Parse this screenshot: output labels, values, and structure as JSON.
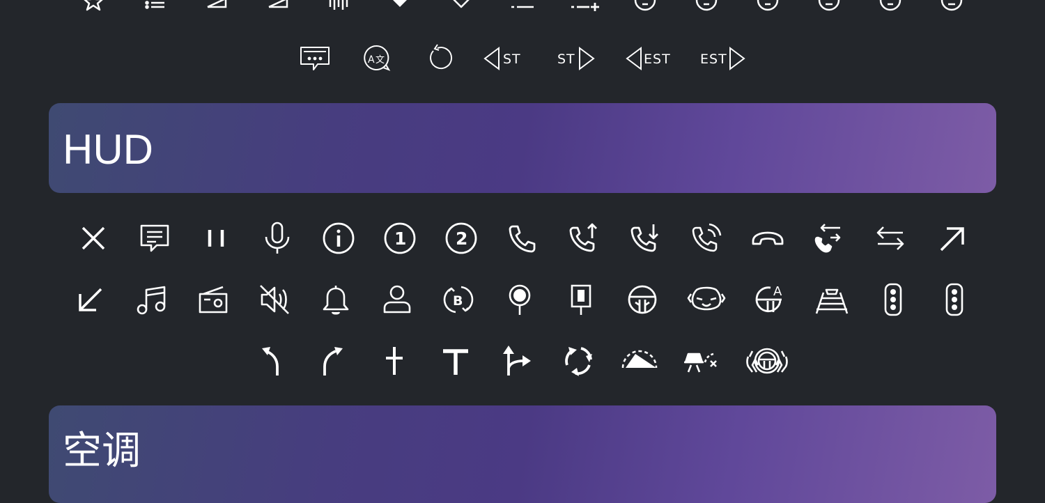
{
  "sections": {
    "hud": {
      "title": "HUD"
    },
    "ac": {
      "title": "空调"
    }
  },
  "labels": {
    "st_left": "ST",
    "st_right": "ST",
    "est_left": "EST",
    "est_right": "EST"
  },
  "icons": [
    "bookmark-star-icon",
    "bullet-list-icon",
    "triangle-corner-icon",
    "triangle-corner-alt-icon",
    "equalizer-icon",
    "heart-filled-icon",
    "heart-outline-icon",
    "list-dash-icon",
    "list-add-icon",
    "circle-badge-icon",
    "message-more-icon",
    "translate-icon",
    "refresh-icon",
    "previous-station-icon",
    "next-station-icon",
    "previous-scan-icon",
    "next-scan-icon",
    "close-icon",
    "chat-icon",
    "pause-icon",
    "microphone-icon",
    "info-icon",
    "number-one-icon",
    "number-two-icon",
    "phone-icon",
    "outgoing-call-icon",
    "incoming-call-icon",
    "phone-ringing-icon",
    "hang-up-icon",
    "call-transfer-icon",
    "swap-arrows-icon",
    "arrow-up-right-icon",
    "arrow-down-left-icon",
    "music-note-icon",
    "radio-icon",
    "mute-icon",
    "bell-icon",
    "user-icon",
    "bluetooth-sync-icon",
    "location-pin-icon",
    "signpost-icon",
    "steering-wheel-icon",
    "driver-monitor-icon",
    "auto-steering-icon",
    "lane-assist-icon",
    "traffic-light-icon",
    "traffic-light-alt-icon",
    "turn-left-icon",
    "turn-right-icon",
    "straight-cross-icon",
    "t-junction-icon",
    "fork-right-icon",
    "u-turn-cycle-icon",
    "speed-warning-icon",
    "collision-warning-icon",
    "hands-on-wheel-icon"
  ]
}
